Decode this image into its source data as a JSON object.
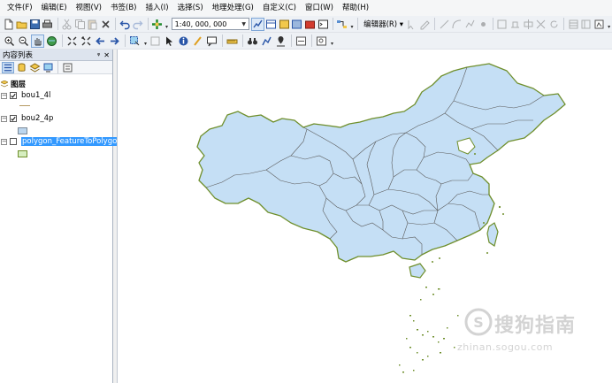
{
  "menu": [
    "文件(F)",
    "编辑(E)",
    "视图(V)",
    "书签(B)",
    "插入(I)",
    "选择(S)",
    "地理处理(G)",
    "自定义(C)",
    "窗口(W)",
    "帮助(H)"
  ],
  "toolbar": {
    "scale_value": "1:40, 000, 000",
    "editor_label": "编辑器(R) ▾"
  },
  "toc": {
    "title": "内容列表",
    "pin": "ᵠ",
    "close": "✕",
    "root_label": "图层",
    "layers": [
      {
        "name": "bou1_4l",
        "checked": true,
        "symbol": "line",
        "symbol_color": "#b59a63"
      },
      {
        "name": "bou2_4p",
        "checked": true,
        "symbol": "fill",
        "symbol_color": "#bcd6ee"
      },
      {
        "name": "polygon_FeatureToPolygon",
        "checked": false,
        "selected": true,
        "symbol": "fill",
        "symbol_color": "#d6eec0"
      }
    ]
  },
  "map": {
    "land_color": "#c5dff5",
    "border_color": "#6f8f2c",
    "province_line_color": "#5b5b5b"
  },
  "watermark": {
    "brand": "搜狗指南",
    "url": "zhinan.sogou.com"
  },
  "colors": {
    "selection": "#3399ff",
    "panel_header": "#dde4ee"
  }
}
